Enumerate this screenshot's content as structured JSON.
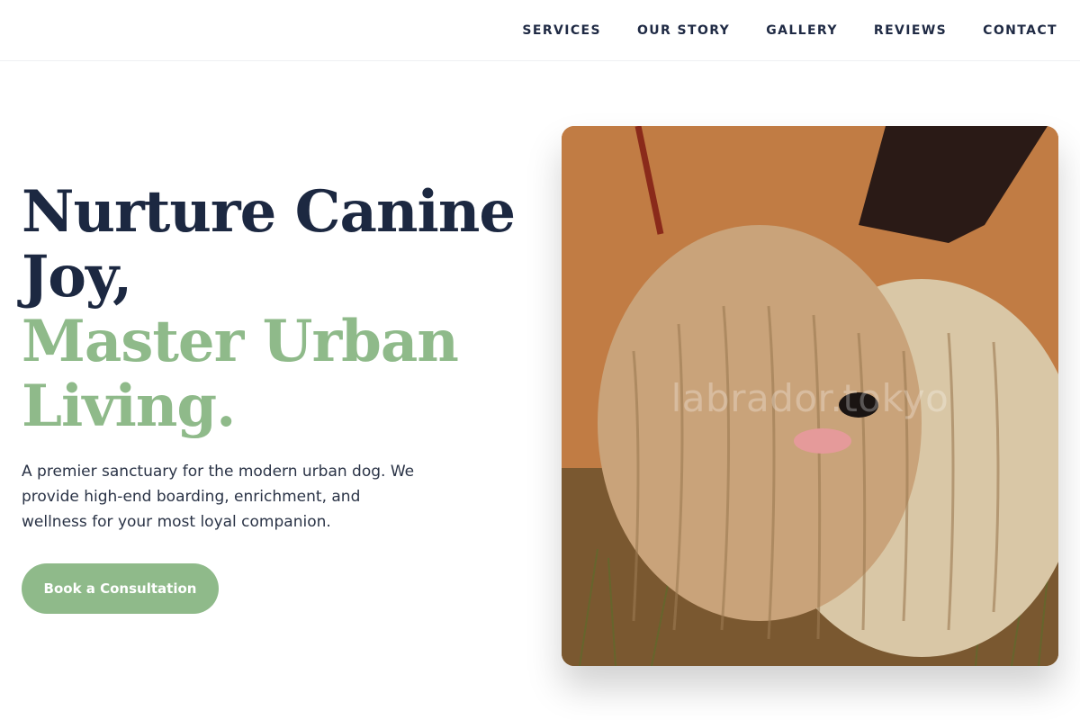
{
  "nav": {
    "links": [
      "SERVICES",
      "OUR STORY",
      "GALLERY",
      "REVIEWS",
      "CONTACT"
    ]
  },
  "hero": {
    "title_line1": "Nurture Canine",
    "title_line2": "Joy,",
    "title_line3": "Master Urban",
    "title_line4": "Living.",
    "description": "A premier sanctuary for the modern urban dog. We provide high-end boarding, enrichment, and wellness for your most loyal companion.",
    "cta_label": "Book a Consultation",
    "image_watermark": "labrador.tokyo"
  },
  "colors": {
    "text_dark": "#1c2841",
    "accent_green": "#8fba8a",
    "background": "#ffffff"
  }
}
